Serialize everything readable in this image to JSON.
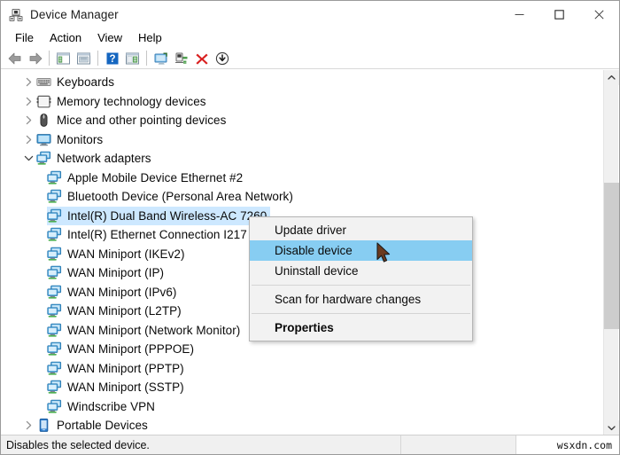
{
  "window": {
    "title": "Device Manager",
    "icon": "device-manager-icon",
    "caption": {
      "minimize": "–",
      "maximize": "□",
      "close": "✕"
    }
  },
  "menubar": {
    "items": [
      {
        "label": "File"
      },
      {
        "label": "Action"
      },
      {
        "label": "View"
      },
      {
        "label": "Help"
      }
    ]
  },
  "toolbar": {
    "buttons": [
      {
        "name": "back-icon",
        "tooltip": "Back"
      },
      {
        "name": "forward-icon",
        "tooltip": "Forward"
      },
      {
        "name": "show-hide-console-tree-icon",
        "tooltip": "Show/Hide Console Tree"
      },
      {
        "name": "properties-icon",
        "tooltip": "Properties"
      },
      {
        "name": "help-icon",
        "tooltip": "Help"
      },
      {
        "name": "show-hide-action-pane-icon",
        "tooltip": "Show/Hide Action Pane"
      },
      {
        "name": "scan-for-hardware-changes-icon",
        "tooltip": "Scan for hardware changes"
      },
      {
        "name": "update-driver-icon",
        "tooltip": "Update driver"
      },
      {
        "name": "uninstall-device-icon",
        "tooltip": "Uninstall device"
      },
      {
        "name": "disable-device-icon",
        "tooltip": "Disable device"
      }
    ]
  },
  "tree": {
    "rows": [
      {
        "label": "Keyboards",
        "indent": 0,
        "icon": "keyboard-icon",
        "twisty": "collapsed",
        "selected": false
      },
      {
        "label": "Memory technology devices",
        "indent": 0,
        "icon": "memory-card-icon",
        "twisty": "collapsed",
        "selected": false
      },
      {
        "label": "Mice and other pointing devices",
        "indent": 0,
        "icon": "mouse-icon",
        "twisty": "collapsed",
        "selected": false
      },
      {
        "label": "Monitors",
        "indent": 0,
        "icon": "monitor-icon",
        "twisty": "collapsed",
        "selected": false
      },
      {
        "label": "Network adapters",
        "indent": 0,
        "icon": "network-adapter-icon",
        "twisty": "expanded",
        "selected": false
      },
      {
        "label": "Apple Mobile Device Ethernet #2",
        "indent": 1,
        "icon": "network-adapter-icon",
        "twisty": "none",
        "selected": false
      },
      {
        "label": "Bluetooth Device (Personal Area Network)",
        "indent": 1,
        "icon": "network-adapter-icon",
        "twisty": "none",
        "selected": false
      },
      {
        "label": "Intel(R) Dual Band Wireless-AC 7260",
        "indent": 1,
        "icon": "network-adapter-icon",
        "twisty": "none",
        "selected": true
      },
      {
        "label": "Intel(R) Ethernet Connection I217",
        "indent": 1,
        "icon": "network-adapter-icon",
        "twisty": "none",
        "selected": false
      },
      {
        "label": "WAN Miniport (IKEv2)",
        "indent": 1,
        "icon": "network-adapter-icon",
        "twisty": "none",
        "selected": false
      },
      {
        "label": "WAN Miniport (IP)",
        "indent": 1,
        "icon": "network-adapter-icon",
        "twisty": "none",
        "selected": false
      },
      {
        "label": "WAN Miniport (IPv6)",
        "indent": 1,
        "icon": "network-adapter-icon",
        "twisty": "none",
        "selected": false
      },
      {
        "label": "WAN Miniport (L2TP)",
        "indent": 1,
        "icon": "network-adapter-icon",
        "twisty": "none",
        "selected": false
      },
      {
        "label": "WAN Miniport (Network Monitor)",
        "indent": 1,
        "icon": "network-adapter-icon",
        "twisty": "none",
        "selected": false
      },
      {
        "label": "WAN Miniport (PPPOE)",
        "indent": 1,
        "icon": "network-adapter-icon",
        "twisty": "none",
        "selected": false
      },
      {
        "label": "WAN Miniport (PPTP)",
        "indent": 1,
        "icon": "network-adapter-icon",
        "twisty": "none",
        "selected": false
      },
      {
        "label": "WAN Miniport (SSTP)",
        "indent": 1,
        "icon": "network-adapter-icon",
        "twisty": "none",
        "selected": false
      },
      {
        "label": "Windscribe VPN",
        "indent": 1,
        "icon": "network-adapter-icon",
        "twisty": "none",
        "selected": false
      },
      {
        "label": "Portable Devices",
        "indent": 0,
        "icon": "portable-device-icon",
        "twisty": "collapsed",
        "selected": false
      }
    ]
  },
  "context_menu": {
    "items": [
      {
        "label": "Update driver",
        "type": "item",
        "highlighted": false,
        "bold": false
      },
      {
        "label": "Disable device",
        "type": "item",
        "highlighted": true,
        "bold": false
      },
      {
        "label": "Uninstall device",
        "type": "item",
        "highlighted": false,
        "bold": false
      },
      {
        "label": "",
        "type": "separator",
        "highlighted": false,
        "bold": false
      },
      {
        "label": "Scan for hardware changes",
        "type": "item",
        "highlighted": false,
        "bold": false
      },
      {
        "label": "",
        "type": "separator",
        "highlighted": false,
        "bold": false
      },
      {
        "label": "Properties",
        "type": "item",
        "highlighted": false,
        "bold": true
      }
    ]
  },
  "statusbar": {
    "message": "Disables the selected device.",
    "pane2": "",
    "watermark": "wsxdn.com"
  },
  "colors": {
    "selection_blue": "#cde8ff",
    "menu_highlight": "#87cdf2",
    "scrollbar_thumb": "#cdcdcd",
    "statusbar_bg": "#f0f0f0"
  },
  "scrollbar": {
    "up_arrow": "⌃",
    "down_arrow": "⌄"
  }
}
